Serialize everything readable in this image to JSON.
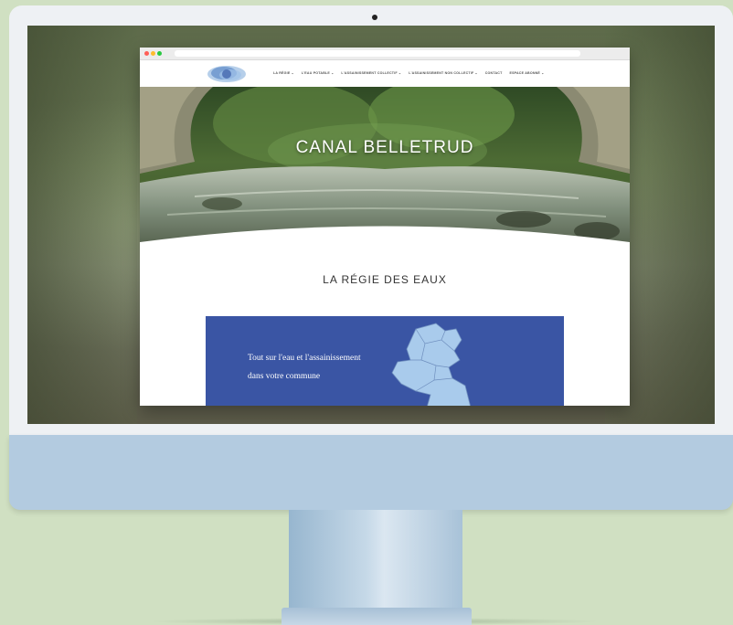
{
  "site": {
    "menu": [
      "LA RÉGIE ⌄",
      "L'EAU POTABLE ⌄",
      "L'ASSAINISSEMENT COLLECTIF ⌄",
      "L'ASSAINISSEMENT NON COLLECTIF ⌄",
      "CONTACT",
      "ESPACE ABONNÉ ⌄"
    ],
    "hero_title": "CANAL BELLETRUD",
    "section_title": "LA RÉGIE DES EAUX",
    "banner_line1": "Tout sur l'eau et l'assainissement",
    "banner_line2": "dans votre commune"
  },
  "icons": [
    "camera-icon",
    "site-logo",
    "commune-map-icon"
  ],
  "colors": {
    "background": "#d0e0c2",
    "bezel": "#eef1f4",
    "chin": "#b3cbe0",
    "banner": "#3a55a4",
    "map_fill": "#a9cbec"
  }
}
